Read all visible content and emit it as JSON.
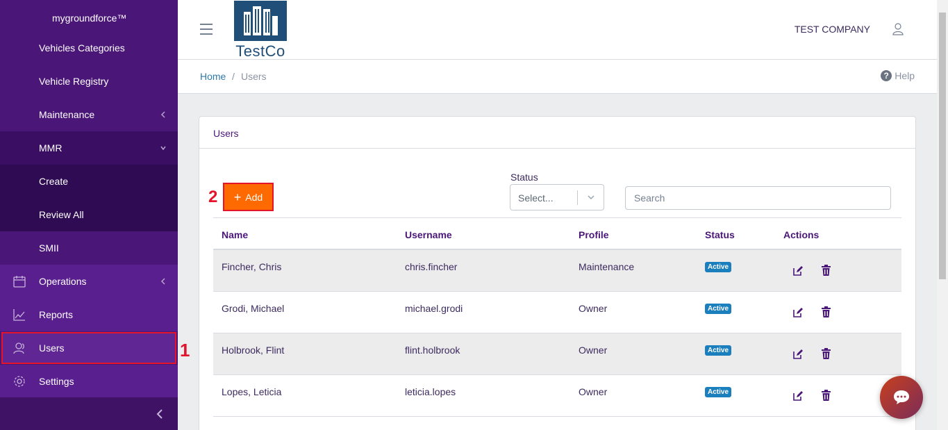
{
  "sidebar": {
    "brand": "mygroundforce™",
    "items": [
      {
        "label": "Vehicles Categories"
      },
      {
        "label": "Vehicle Registry"
      },
      {
        "label": "Maintenance"
      },
      {
        "label": "MMR"
      },
      {
        "label": "Create"
      },
      {
        "label": "Review All"
      },
      {
        "label": "SMII"
      },
      {
        "label": "Operations",
        "icon": "calendar-icon"
      },
      {
        "label": "Reports",
        "icon": "chart-line-icon"
      },
      {
        "label": "Users",
        "icon": "users-icon"
      },
      {
        "label": "Settings",
        "icon": "gear-icon"
      }
    ]
  },
  "header": {
    "logo_text": "TestCo",
    "company": "TEST COMPANY"
  },
  "breadcrumb": {
    "home": "Home",
    "separator": "/",
    "current": "Users",
    "help": "Help"
  },
  "card": {
    "title": "Users",
    "add_label": "Add",
    "status_label": "Status",
    "status_placeholder": "Select...",
    "search_placeholder": "Search"
  },
  "annotations": {
    "users": "1",
    "add": "2"
  },
  "table": {
    "headers": [
      "Name",
      "Username",
      "Profile",
      "Status",
      "Actions"
    ],
    "rows": [
      {
        "name": "Fincher, Chris",
        "username": "chris.fincher",
        "profile": "Maintenance",
        "status": "Active"
      },
      {
        "name": "Grodi, Michael",
        "username": "michael.grodi",
        "profile": "Owner",
        "status": "Active"
      },
      {
        "name": "Holbrook, Flint",
        "username": "flint.holbrook",
        "profile": "Owner",
        "status": "Active"
      },
      {
        "name": "Lopes, Leticia",
        "username": "leticia.lopes",
        "profile": "Owner",
        "status": "Active"
      }
    ]
  },
  "colors": {
    "sidebar": "#4a1678",
    "accent": "#ff6a00",
    "badge": "#1b7fbd",
    "annotation": "#e3142b"
  }
}
